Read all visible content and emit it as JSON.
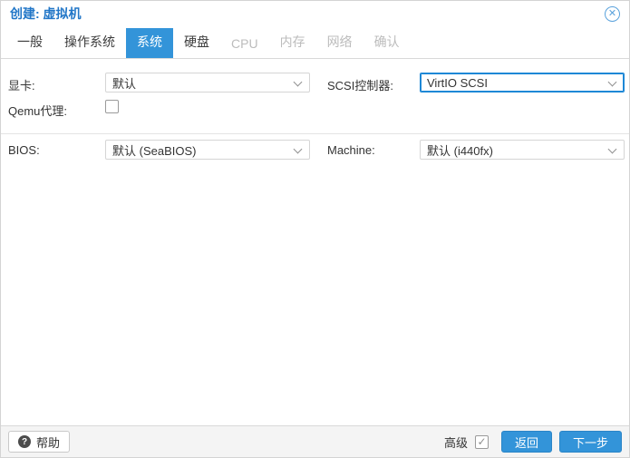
{
  "window": {
    "title": "创建: 虚拟机"
  },
  "icons": {
    "close_glyph": "✕",
    "help_glyph": "?",
    "check_glyph": "✓"
  },
  "tabs": [
    {
      "label": "一般",
      "state": "normal"
    },
    {
      "label": "操作系统",
      "state": "normal"
    },
    {
      "label": "系统",
      "state": "active"
    },
    {
      "label": "硬盘",
      "state": "normal"
    },
    {
      "label": "CPU",
      "state": "disabled"
    },
    {
      "label": "内存",
      "state": "disabled"
    },
    {
      "label": "网络",
      "state": "disabled"
    },
    {
      "label": "确认",
      "state": "disabled"
    }
  ],
  "fields": {
    "graphics": {
      "label": "显卡:",
      "type": "select",
      "value": "默认"
    },
    "scsi": {
      "label": "SCSI控制器:",
      "type": "select",
      "value": "VirtIO SCSI",
      "focused": true
    },
    "qemu_agent": {
      "label": "Qemu代理:",
      "type": "checkbox",
      "checked": false
    },
    "bios": {
      "label": "BIOS:",
      "type": "select",
      "value": "默认 (SeaBIOS)"
    },
    "machine": {
      "label": "Machine:",
      "type": "select",
      "value": "默认 (i440fx)"
    }
  },
  "footer": {
    "help_label": "帮助",
    "advanced_label": "高级",
    "advanced_checked": true,
    "back_label": "返回",
    "next_label": "下一步"
  },
  "colors": {
    "accent": "#3394d9",
    "title_blue": "#2176c7",
    "focus_border": "#1e88d6",
    "disabled_tab": "#bcbcbc",
    "footer_bg": "#f4f4f4"
  }
}
